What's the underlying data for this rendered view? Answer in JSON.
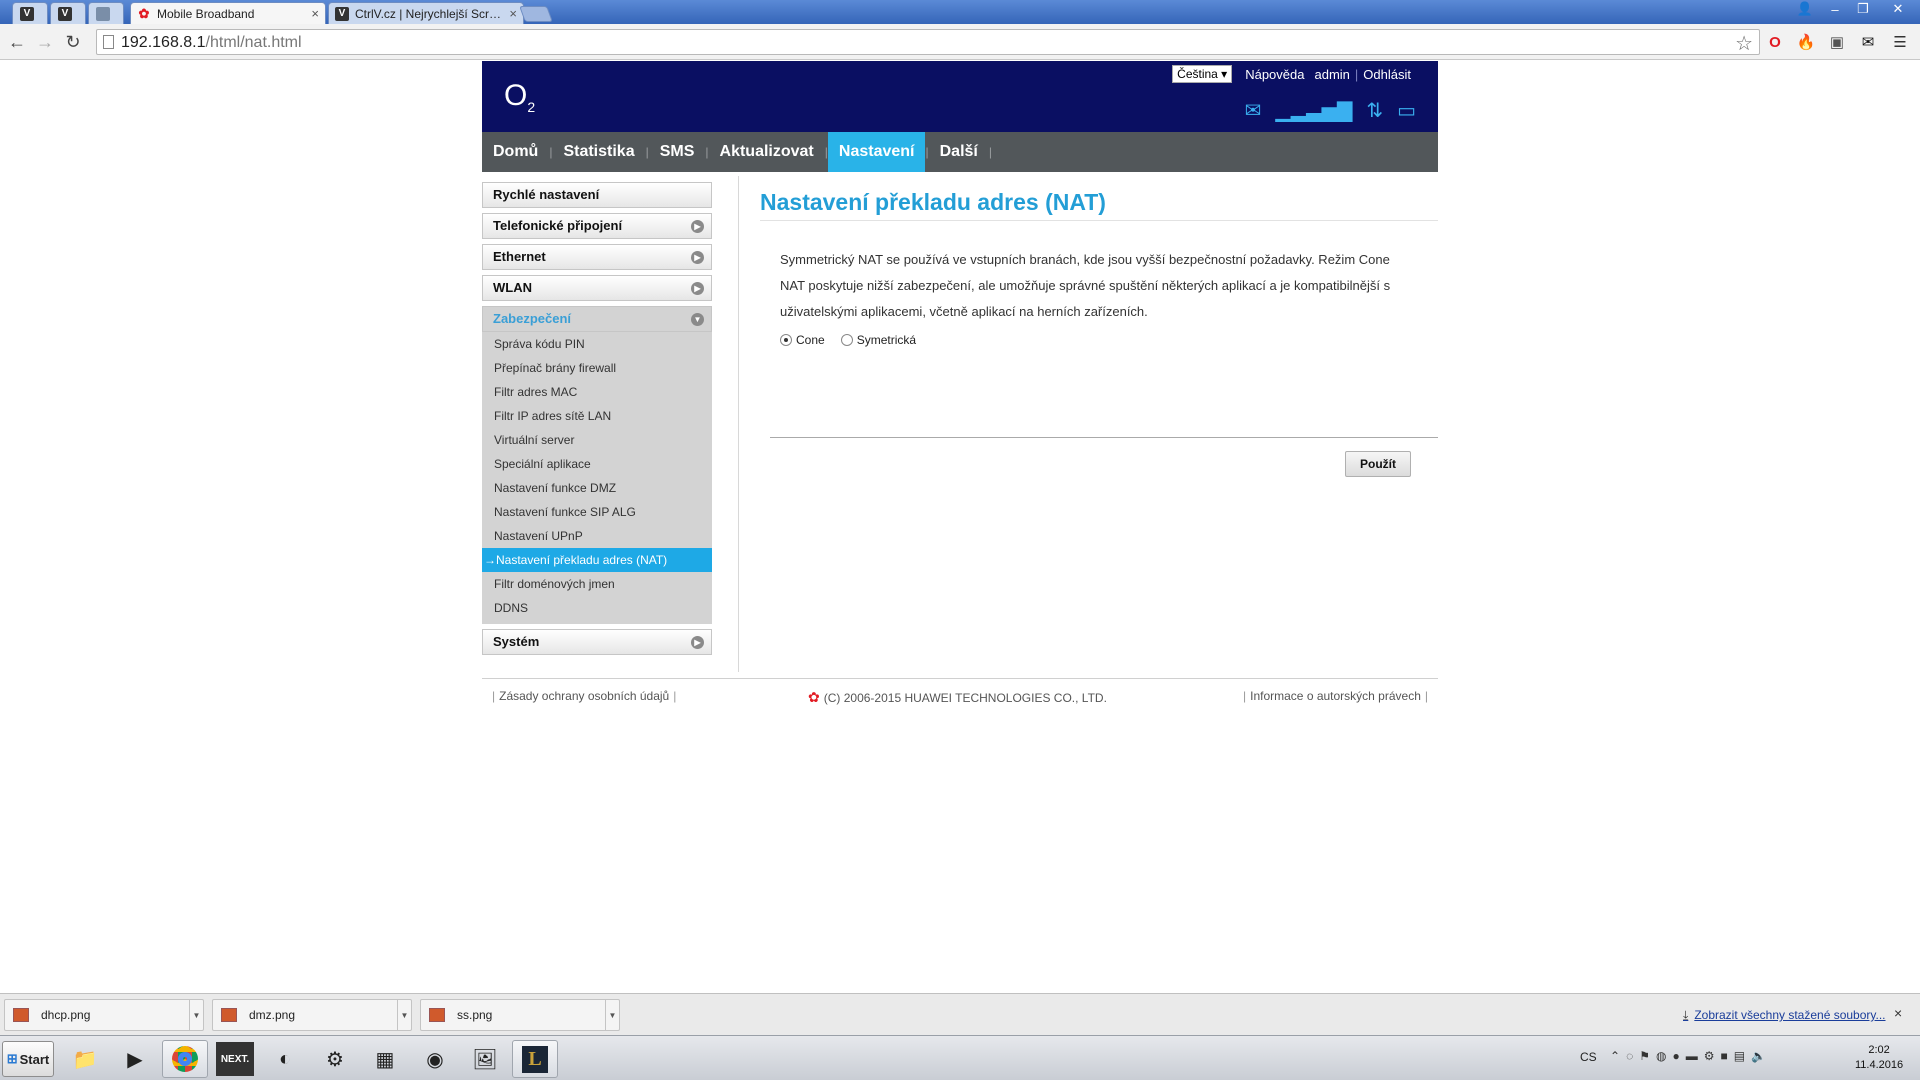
{
  "browser": {
    "tabs": [
      {
        "label": "",
        "icon": "vivaldi-icon"
      },
      {
        "label": "",
        "icon": "vivaldi-icon"
      },
      {
        "label": "",
        "icon": "computer-icon"
      },
      {
        "label": "Mobile Broadband",
        "icon": "huawei-icon",
        "active": true
      },
      {
        "label": "CtrlV.cz | Nejrychlejší Screen",
        "icon": "vivaldi-icon"
      }
    ],
    "url_host": "192.168.8.1",
    "url_path": "/html/nat.html"
  },
  "header": {
    "logo_main": "O",
    "logo_sub": "2",
    "language": "Čeština ▾",
    "links": {
      "help": "Nápověda",
      "user": "admin",
      "logout": "Odhlásit"
    }
  },
  "nav": {
    "items": [
      {
        "label": "Domů"
      },
      {
        "label": "Statistika"
      },
      {
        "label": "SMS"
      },
      {
        "label": "Aktualizovat"
      },
      {
        "label": "Nastavení",
        "active": true
      },
      {
        "label": "Další"
      }
    ]
  },
  "sidebar": {
    "quick": "Rychlé nastavení",
    "dialup": "Telefonické připojení",
    "ethernet": "Ethernet",
    "wlan": "WLAN",
    "security": "Zabezpečení",
    "security_items": [
      "Správa kódu PIN",
      "Přepínač brány firewall",
      "Filtr adres MAC",
      "Filtr IP adres sítě LAN",
      "Virtuální server",
      "Speciální aplikace",
      "Nastavení funkce DMZ",
      "Nastavení funkce SIP ALG",
      "Nastavení UPnP",
      "Nastavení překladu adres (NAT)",
      "Filtr doménových jmen",
      "DDNS"
    ],
    "active_item_prefix": "→",
    "system": "Systém"
  },
  "content": {
    "title": "Nastavení překladu adres (NAT)",
    "description": "Symmetrický NAT se používá ve vstupních branách, kde jsou vyšší bezpečnostní požadavky. Režim Cone NAT poskytuje nižší zabezpečení, ale umožňuje správné spuštění některých aplikací a je kompatibilnější s uživatelskými aplikacemi, včetně aplikací na herních zařízeních.",
    "nat_options": [
      {
        "label": "Cone",
        "checked": true
      },
      {
        "label": "Symetrická",
        "checked": false
      }
    ],
    "apply_label": "Použít"
  },
  "footer": {
    "privacy": "Zásady ochrany osobních údajů",
    "copyright": "(C) 2006-2015 HUAWEI TECHNOLOGIES CO., LTD.",
    "license": "Informace o autorských právech"
  },
  "downloads": {
    "files": [
      "dhcp.png",
      "dmz.png",
      "ss.png"
    ],
    "show_all": "Zobrazit všechny stažené soubory...",
    "close": "×"
  },
  "taskbar": {
    "start_label": "Start",
    "language": "CS",
    "time": "2:02",
    "date": "11.4.2016"
  }
}
